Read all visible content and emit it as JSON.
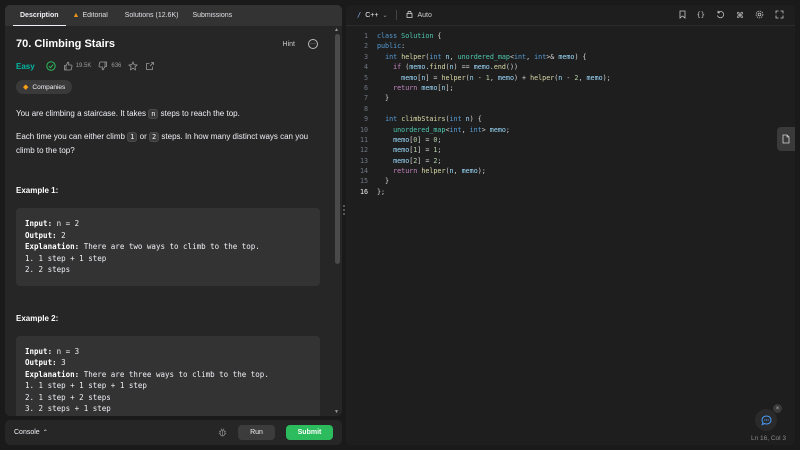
{
  "colors": {
    "accent_orange": "#ffa116",
    "easy_green": "#00b8a3",
    "submit_green": "#2cbb5d",
    "panel_bg": "#262626",
    "editor_bg": "#1e1e1e"
  },
  "left_tabs": [
    {
      "label": "Description",
      "icon": ""
    },
    {
      "label": "Editorial",
      "icon": "flask-icon"
    },
    {
      "label": "Solutions (12.6K)",
      "icon": "beaker-icon"
    },
    {
      "label": "Submissions",
      "icon": "history-icon"
    }
  ],
  "problem": {
    "title": "70. Climbing Stairs",
    "hint_label": "Hint",
    "difficulty": "Easy",
    "likes": "19.5K",
    "dislikes": "636",
    "companies_label": "Companies",
    "desc_p1_a": "You are climbing a staircase. It takes ",
    "desc_p1_code": "n",
    "desc_p1_b": " steps to reach the top.",
    "desc_p2_a": "Each time you can either climb ",
    "desc_p2_code1": "1",
    "desc_p2_mid": " or ",
    "desc_p2_code2": "2",
    "desc_p2_b": " steps. In how many distinct ways can you climb to the top?",
    "example1_title": "Example 1:",
    "example1": {
      "input_label": "Input:",
      "input": " n = 2",
      "output_label": "Output:",
      "output": " 2",
      "explanation_label": "Explanation:",
      "explanation": " There are two ways to climb to the top.",
      "steps": [
        "1. 1 step + 1 step",
        "2. 2 steps"
      ]
    },
    "example2_title": "Example 2:",
    "example2": {
      "input_label": "Input:",
      "input": " n = 3",
      "output_label": "Output:",
      "output": " 3",
      "explanation_label": "Explanation:",
      "explanation": " There are three ways to climb to the top.",
      "steps": [
        "1. 1 step + 1 step + 1 step",
        "2. 1 step + 2 steps",
        "3. 2 steps + 1 step"
      ]
    }
  },
  "bottom_bar": {
    "console_label": "Console",
    "run_label": "Run",
    "submit_label": "Submit"
  },
  "editor": {
    "language": "C++",
    "auto_label": "Auto",
    "status": "Ln 16, Col 3",
    "active_line": 16,
    "icons": [
      "bookmark-icon",
      "braces-icon",
      "reset-icon",
      "command-icon",
      "settings-icon",
      "expand-icon"
    ],
    "lines": [
      "class Solution {",
      "public:",
      "  int helper(int n, unordered_map<int, int>& memo) {",
      "    if (memo.find(n) == memo.end())",
      "      memo[n] = helper(n - 1, memo) + helper(n - 2, memo);",
      "    return memo[n];",
      "  }",
      "",
      "  int climbStairs(int n) {",
      "    unordered_map<int, int> memo;",
      "    memo[0] = 0;",
      "    memo[1] = 1;",
      "    memo[2] = 2;",
      "    return helper(n, memo);",
      "  }",
      "};"
    ]
  }
}
